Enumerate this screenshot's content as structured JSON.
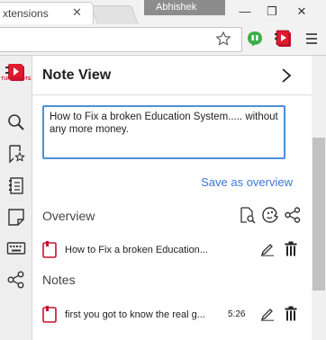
{
  "browser": {
    "tab_title": "xtensions",
    "tab_close_glyph": "✕",
    "profile_name": "Abhishek",
    "window_controls": {
      "minimize": "—",
      "maximize": "❐",
      "close": "✕"
    }
  },
  "toolbar": {
    "icons": [
      "star-icon",
      "green-extension-icon",
      "turbonote-extension-icon",
      "menu-icon"
    ]
  },
  "rail": {
    "brand_text": "TURBONOTE",
    "icons": [
      "search-icon",
      "bookmark-star-icon",
      "notes-list-icon",
      "page-corner-icon",
      "keyboard-icon",
      "share-icon"
    ]
  },
  "panel": {
    "title": "Note View",
    "next_glyph": "›",
    "editor_text": "How to Fix a broken Education System..... without any more money.",
    "save_overview_label": "Save as overview",
    "overview_title": "Overview",
    "overview_items": [
      {
        "text": "How to Fix a broken Education..."
      }
    ],
    "notes_title": "Notes",
    "note_items": [
      {
        "text": "first you got to know the real g...",
        "time": "5:26"
      }
    ]
  },
  "colors": {
    "accent_blue": "#3c78d8",
    "editor_border": "#4d90d6",
    "brand_red": "#c8102e",
    "extension_green": "#3dae4a"
  }
}
